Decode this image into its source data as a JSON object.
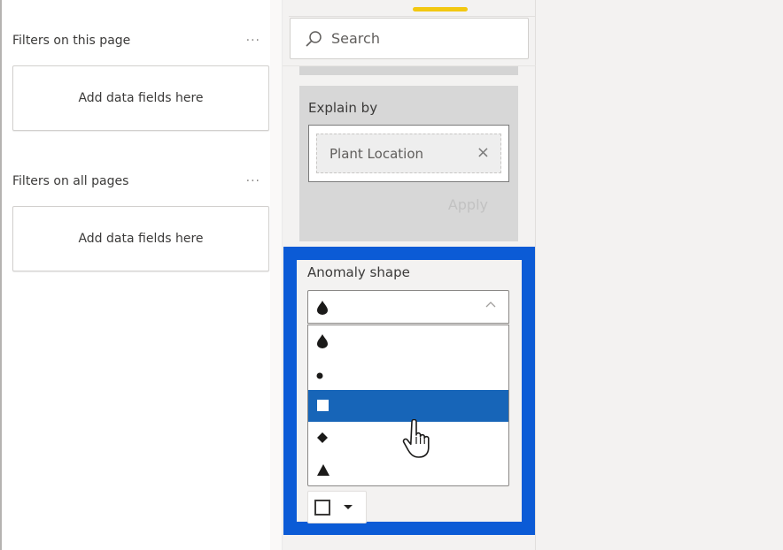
{
  "filters_pane": {
    "sections": [
      {
        "title": "Filters on this page",
        "more_label": "...",
        "well_placeholder": "Add data fields here"
      },
      {
        "title": "Filters on all pages",
        "more_label": "...",
        "well_placeholder": "Add data fields here"
      }
    ]
  },
  "visualizations_pane": {
    "active_tab_indicator_color": "#f2c811",
    "search": {
      "placeholder": "Search",
      "value": "",
      "icon": "search-icon"
    },
    "explain_by": {
      "label": "Explain by",
      "fields": [
        {
          "name": "Plant Location",
          "remove_icon": "×"
        }
      ],
      "apply_label": "Apply"
    },
    "anomaly_shape": {
      "label": "Anomaly shape",
      "selected": "drop",
      "expanded": true,
      "options": [
        {
          "shape": "drop",
          "glyph": "drop-icon"
        },
        {
          "shape": "circle",
          "glyph": "circle-icon"
        },
        {
          "shape": "square",
          "glyph": "square-icon",
          "highlighted": true
        },
        {
          "shape": "diamond",
          "glyph": "diamond-icon"
        },
        {
          "shape": "triangle",
          "glyph": "triangle-icon"
        }
      ],
      "color": {
        "value": "#ffffff",
        "caret_icon": "caret-down-icon"
      }
    },
    "highlight_color": "#0b5bd6",
    "selected_option_color": "#1765b8"
  }
}
